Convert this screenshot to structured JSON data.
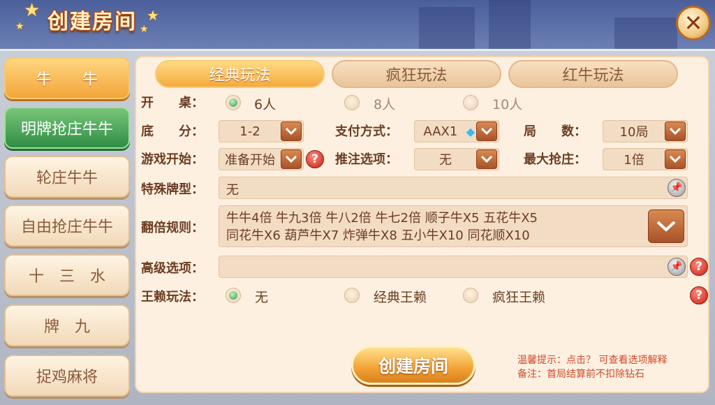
{
  "header": {
    "title": "创建房间",
    "close_icon": "close-x-icon"
  },
  "sidebar": {
    "items": [
      {
        "label": "牛　　牛",
        "state": "active"
      },
      {
        "label": "明牌抢庄牛牛",
        "state": "green"
      },
      {
        "label": "轮庄牛牛",
        "state": "normal"
      },
      {
        "label": "自由抢庄牛牛",
        "state": "normal"
      },
      {
        "label": "十　三　水",
        "state": "normal"
      },
      {
        "label": "牌　九",
        "state": "normal"
      },
      {
        "label": "捉鸡麻将",
        "state": "normal"
      }
    ]
  },
  "tabs": [
    {
      "label": "经典玩法",
      "active": true
    },
    {
      "label": "疯狂玩法",
      "active": false
    },
    {
      "label": "红牛玩法",
      "active": false
    }
  ],
  "form": {
    "table": {
      "label": "开　　桌：",
      "options": [
        "6人",
        "8人",
        "10人"
      ],
      "selected": "6人"
    },
    "base_score": {
      "label": "底　　分：",
      "value": "1-2"
    },
    "payment": {
      "label": "支付方式：",
      "value": "AAX1",
      "icon": "diamond-icon"
    },
    "rounds": {
      "label": "局　　数：",
      "value": "10局"
    },
    "game_start": {
      "label": "游戏开始：",
      "value": "准备开始"
    },
    "push_bet": {
      "label": "推注选项：",
      "value": "无"
    },
    "max_grab": {
      "label": "最大抢庄：",
      "value": "1倍"
    },
    "special_cards": {
      "label": "特殊牌型：",
      "value": "无"
    },
    "multiplier": {
      "label": "翻倍规则：",
      "line1": "牛牛4倍 牛九3倍 牛八2倍 牛七2倍 顺子牛X5 五花牛X5",
      "line2": "同花牛X6 葫芦牛X7 炸弹牛X8 五小牛X10 同花顺X10"
    },
    "advanced": {
      "label": "高级选项：",
      "value": ""
    },
    "wildcard": {
      "label": "王赖玩法：",
      "options": [
        "无",
        "经典王赖",
        "疯狂王赖"
      ],
      "selected": "无"
    }
  },
  "footer": {
    "create_button": "创建房间",
    "hint1": "温馨提示：点击？ 可查看选项解释",
    "hint2": "备注：首局结算前不扣除钻石"
  },
  "colors": {
    "accent_orange": "#f4aa3e",
    "panel_bg": "#fdf0e1",
    "help_red": "#c81e14",
    "radio_green": "#2f9a4a"
  }
}
